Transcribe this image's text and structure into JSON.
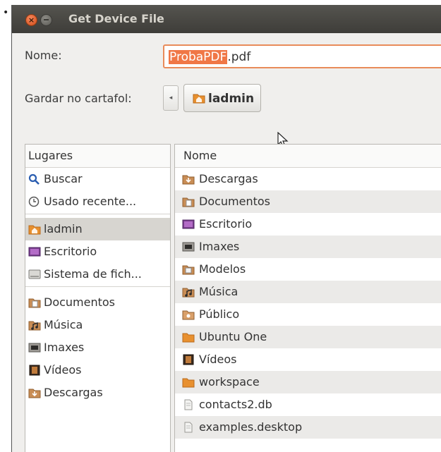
{
  "dialog": {
    "title": "Get Device File",
    "close_glyph": "×",
    "name_label": "Nome:",
    "name_value_selected": "ProbaPDF",
    "name_value_rest": ".pdf",
    "save_in_label": "Gardar no cartafol:",
    "breadcrumb_back": "◂",
    "breadcrumb_current": "ladmin"
  },
  "places": {
    "header": "Lugares",
    "items": [
      {
        "label": "Buscar",
        "icon": "search-icon"
      },
      {
        "label": "Usado recente...",
        "icon": "clock-icon"
      },
      {
        "label": "ladmin",
        "icon": "home-folder-icon",
        "selected": true
      },
      {
        "label": "Escritorio",
        "icon": "desktop-icon"
      },
      {
        "label": "Sistema de fich...",
        "icon": "drive-icon"
      },
      {
        "label": "Documentos",
        "icon": "documents-folder-icon"
      },
      {
        "label": "Música",
        "icon": "music-folder-icon"
      },
      {
        "label": "Imaxes",
        "icon": "pictures-folder-icon"
      },
      {
        "label": "Vídeos",
        "icon": "videos-folder-icon"
      },
      {
        "label": "Descargas",
        "icon": "downloads-folder-icon"
      }
    ]
  },
  "files": {
    "header": "Nome",
    "items": [
      {
        "label": "Descargas",
        "icon": "downloads-folder-icon"
      },
      {
        "label": "Documentos",
        "icon": "documents-folder-icon"
      },
      {
        "label": "Escritorio",
        "icon": "desktop-icon"
      },
      {
        "label": "Imaxes",
        "icon": "pictures-folder-icon"
      },
      {
        "label": "Modelos",
        "icon": "templates-folder-icon"
      },
      {
        "label": "Música",
        "icon": "music-folder-icon"
      },
      {
        "label": "Público",
        "icon": "public-folder-icon"
      },
      {
        "label": "Ubuntu One",
        "icon": "folder-icon"
      },
      {
        "label": "Vídeos",
        "icon": "videos-folder-icon"
      },
      {
        "label": "workspace",
        "icon": "folder-icon"
      },
      {
        "label": "contacts2.db",
        "icon": "file-icon"
      },
      {
        "label": "examples.desktop",
        "icon": "file-icon"
      }
    ]
  },
  "colors": {
    "accent": "#f07746",
    "titlebar": "#3e3d39",
    "folder": "#e8902f"
  }
}
